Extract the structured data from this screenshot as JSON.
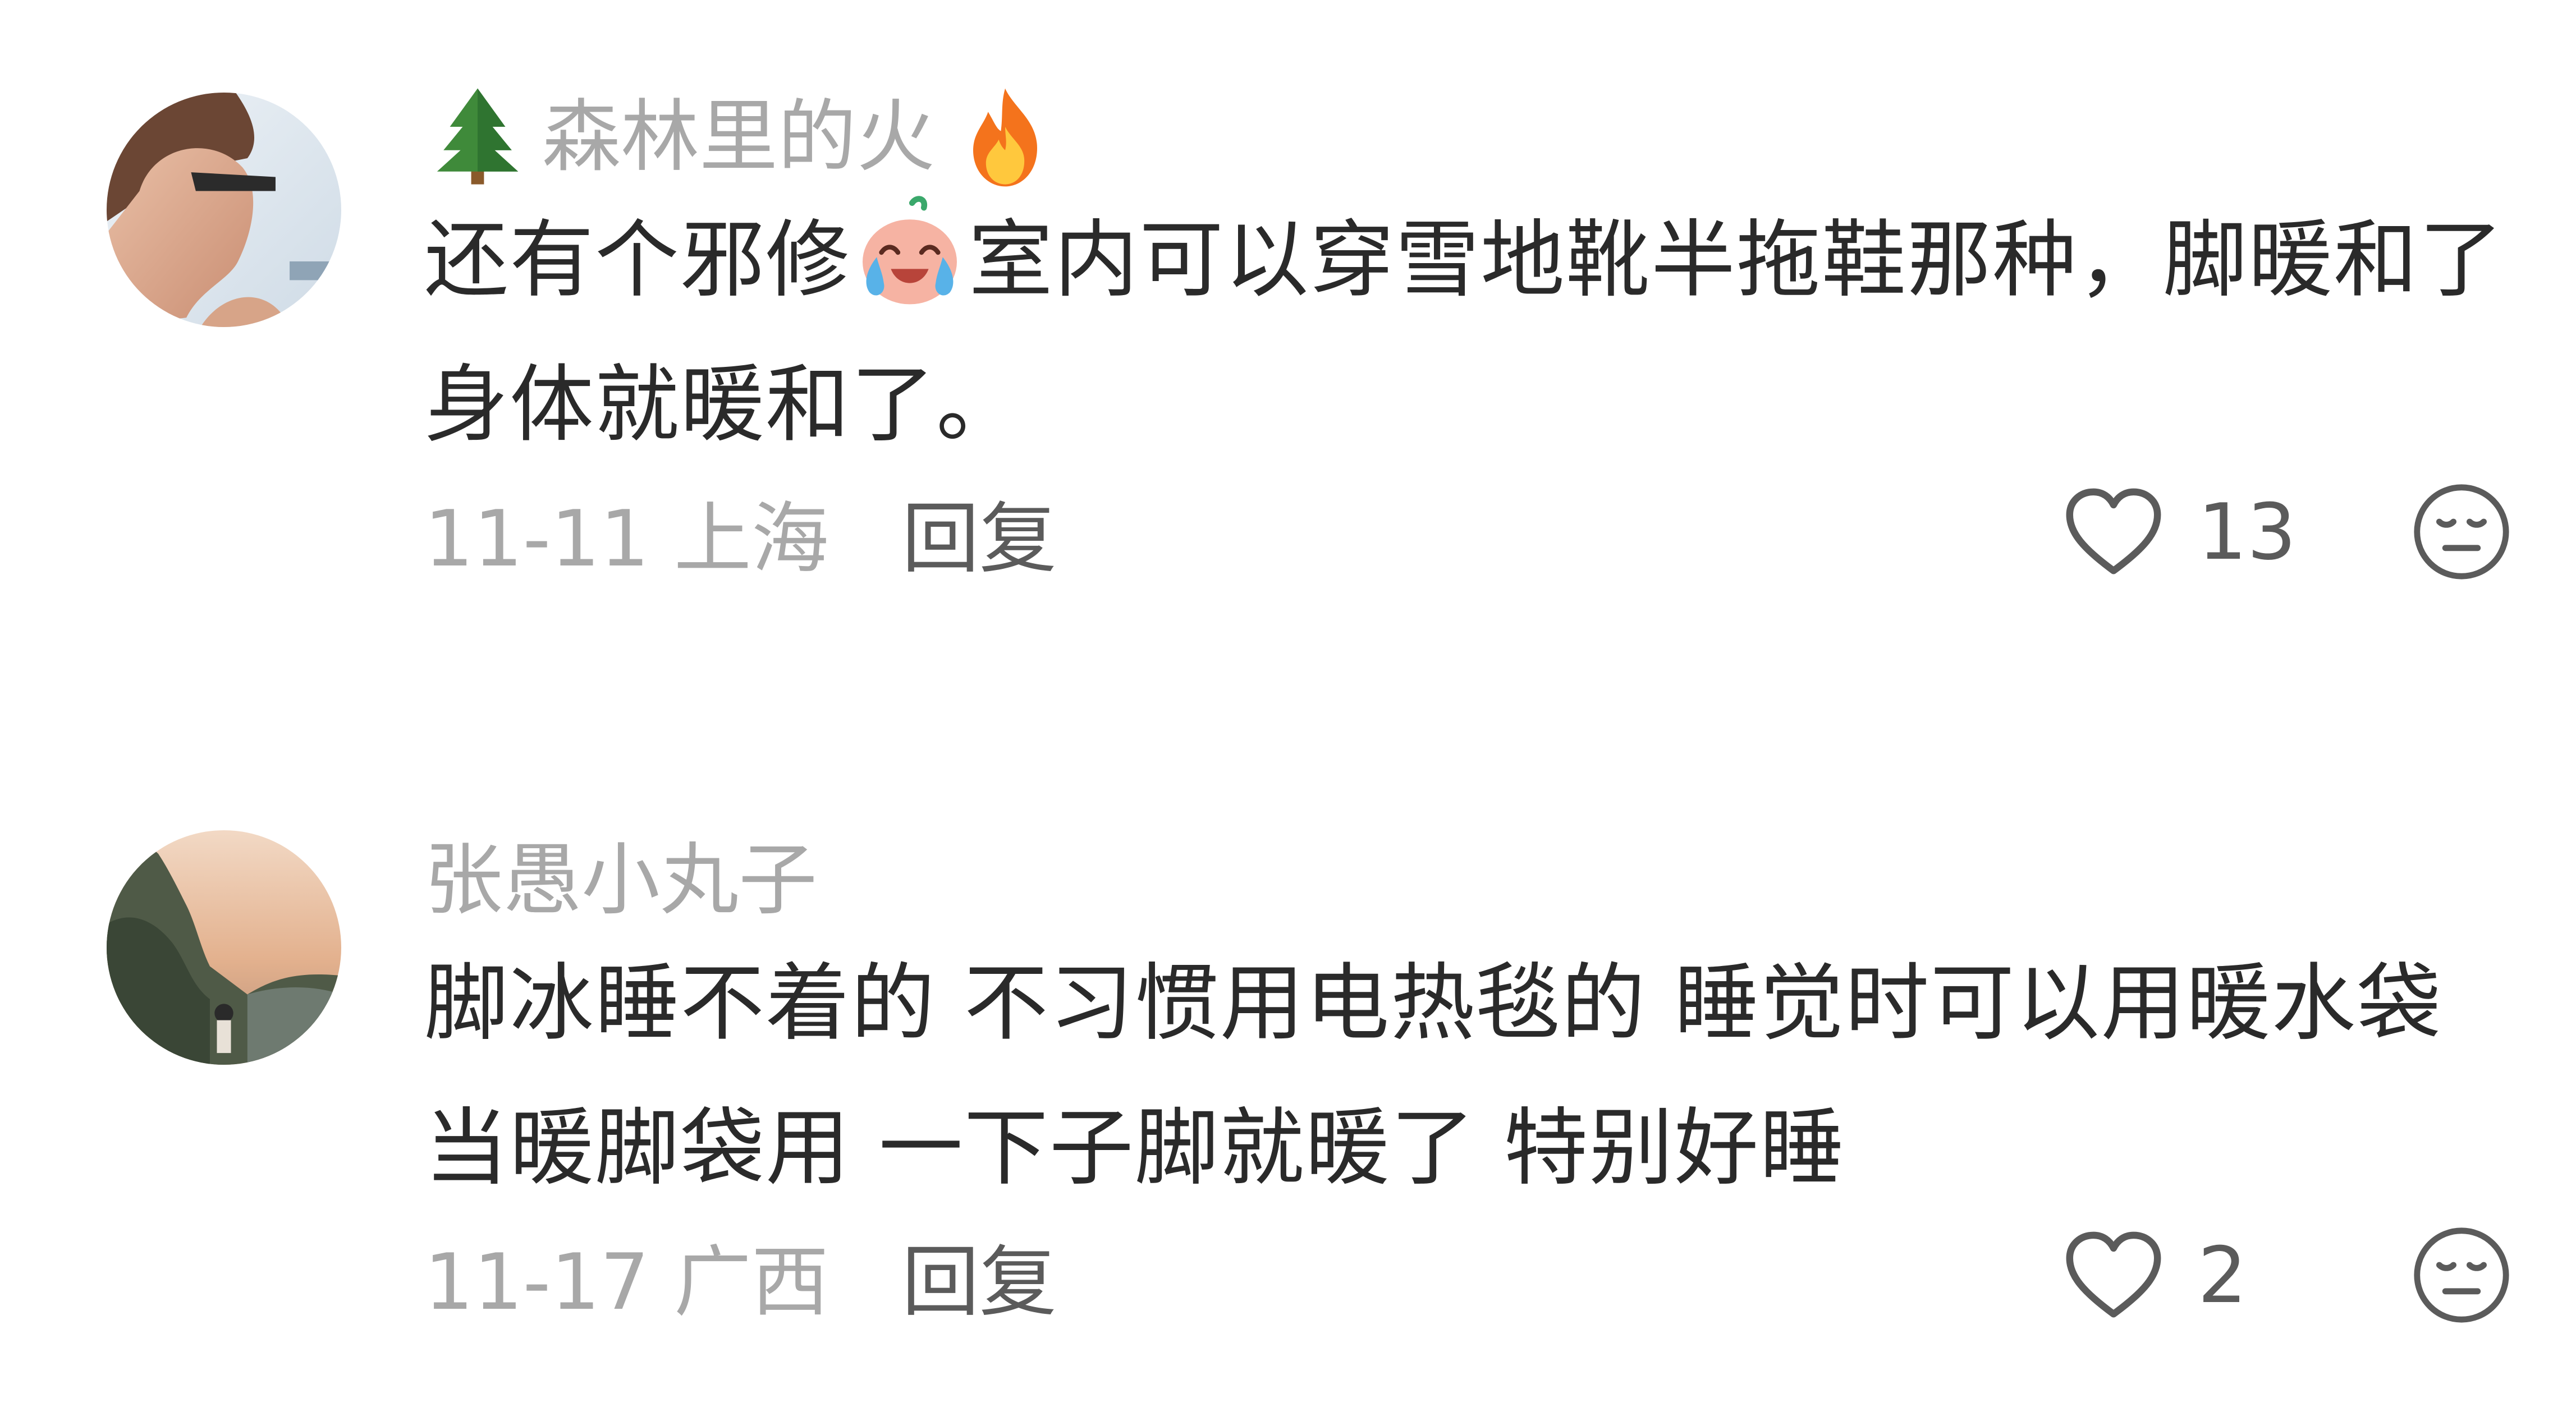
{
  "comments": [
    {
      "username": "森林里的火",
      "username_prefix_icon": "evergreen-tree-emoji",
      "username_suffix_icon": "fire-emoji",
      "text_part1": "还有个邪修",
      "inline_emoji": "crying-face-emoji",
      "text_part2": "室内可以穿雪地靴半拖鞋那种，脚暖和了身体就暖和了。",
      "time_location": "11-11 上海",
      "reply_label": "回复",
      "like_count": "13",
      "like_icon": "heart-outline-icon",
      "dislike_icon": "meh-face-icon"
    },
    {
      "username": "张愚小丸子",
      "text": "脚冰睡不着的 不习惯用电热毯的 睡觉时可以用暖水袋当暖脚袋用 一下子脚就暖了 特别好睡",
      "time_location": "11-17 广西",
      "reply_label": "回复",
      "like_count": "2",
      "like_icon": "heart-outline-icon",
      "dislike_icon": "meh-face-icon"
    }
  ],
  "colors": {
    "username": "#a8a8a8",
    "text": "#2a2a2a",
    "meta": "#a8a8a8",
    "action": "#5b5b5b"
  }
}
